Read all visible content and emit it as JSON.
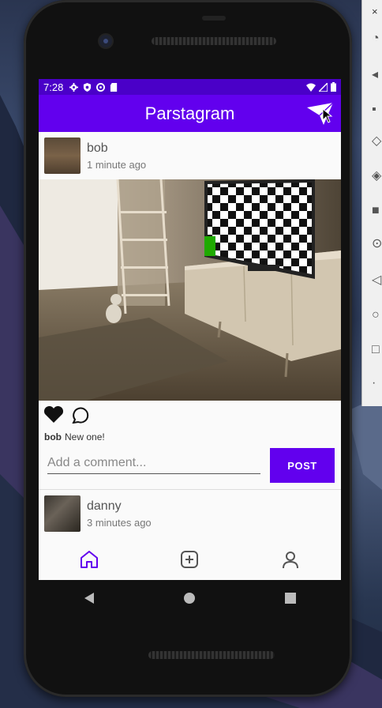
{
  "status_bar": {
    "time": "7:28"
  },
  "app_bar": {
    "title": "Parstagram"
  },
  "posts": [
    {
      "username": "bob",
      "time_ago": "1 minute ago",
      "caption_user": "bob",
      "caption_text": "New one!"
    },
    {
      "username": "danny",
      "time_ago": "3 minutes ago"
    }
  ],
  "comment": {
    "placeholder": "Add a comment...",
    "button_label": "POST"
  },
  "side_panel": {
    "close_label": "×"
  },
  "icons": {
    "status": [
      "settings-icon",
      "shield-icon",
      "data-saver-icon",
      "sd-card-icon",
      "wifi-icon",
      "signal-icon",
      "battery-icon"
    ],
    "bottom_nav": [
      "home-icon",
      "add-box-icon",
      "profile-icon"
    ],
    "system_nav": [
      "back-icon",
      "home-circle-icon",
      "recents-icon"
    ]
  },
  "colors": {
    "primary": "#6200ee",
    "status_bar": "#4a00c8",
    "background": "#fafafa"
  }
}
